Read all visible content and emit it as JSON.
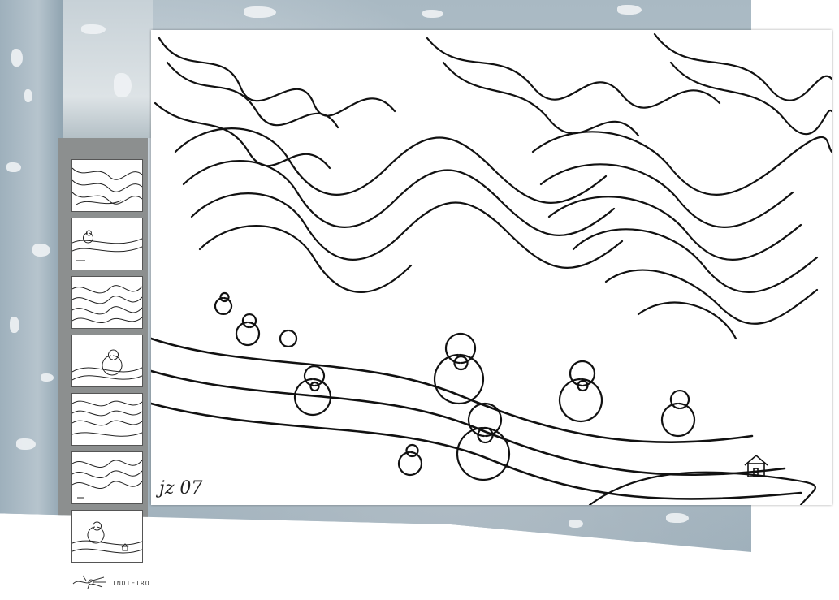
{
  "artwork": {
    "signature_text": "jz 07"
  },
  "thumbnails": [
    {
      "alt": "doodle-1"
    },
    {
      "alt": "doodle-2"
    },
    {
      "alt": "doodle-3"
    },
    {
      "alt": "doodle-4"
    },
    {
      "alt": "doodle-5"
    },
    {
      "alt": "doodle-6"
    },
    {
      "alt": "doodle-7"
    }
  ],
  "nav": {
    "back_label": "INDIETRO"
  }
}
